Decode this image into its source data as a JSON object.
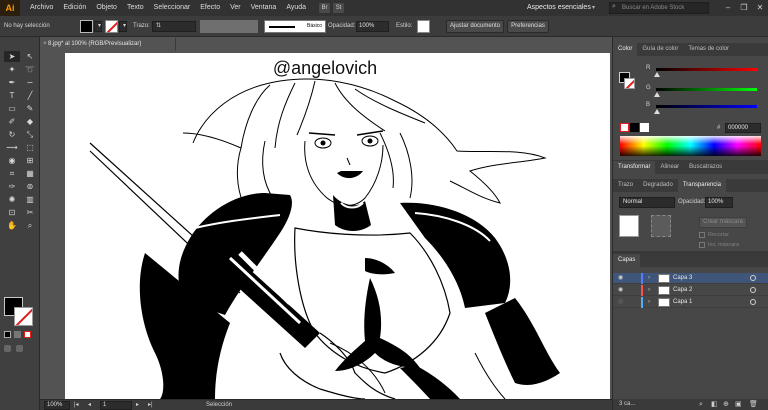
{
  "app": {
    "logo": "Ai"
  },
  "menu": [
    "Archivo",
    "Edición",
    "Objeto",
    "Texto",
    "Seleccionar",
    "Efecto",
    "Ver",
    "Ventana",
    "Ayuda"
  ],
  "bridge_icons": [
    "Br",
    "St"
  ],
  "workspace": {
    "label": "Aspectos esenciales",
    "arrow": "▾"
  },
  "search": {
    "placeholder": "Buscar en Adobe Stock",
    "icon": "search-icon"
  },
  "window_buttons": [
    "–",
    "❐",
    "✕"
  ],
  "control_bar": {
    "selection": "No hay selección",
    "stroke_label": "Trazo:",
    "stroke_profile": "Básico",
    "opacity_label": "Opacidad:",
    "opacity_value": "100%",
    "style_label": "Estilo:",
    "doc_setup_button": "Ajustar documento",
    "preferences_button": "Preferencias"
  },
  "document": {
    "tab_title": "8.jpg* al 100% (RGB/Previsualizar)",
    "close": "×",
    "watermark": "@angelovich"
  },
  "status_bar": {
    "zoom": "100%",
    "artboard": "1",
    "nav_first": "|◂",
    "nav_prev": "◂",
    "nav_next": "▸",
    "nav_last": "▸|",
    "tool": "Selección"
  },
  "color_panel": {
    "tabs": [
      "Color",
      "Guía de color",
      "Temas de color"
    ],
    "channels": [
      "R",
      "G",
      "B"
    ],
    "hex_label": "#",
    "hex_value": "000000"
  },
  "transform_panel": {
    "tabs": [
      "Transformar",
      "Alinear",
      "Buscatrazos"
    ]
  },
  "transparency_panel": {
    "tabs": [
      "Trazo",
      "Degradado",
      "Transparencia"
    ],
    "blend_mode": "Normal",
    "opacity_label": "Opacidad:",
    "opacity_value": "100%",
    "mask_button": "Crear máscara",
    "clip_label": "Recortar",
    "invert_label": "Inv. máscara"
  },
  "layers_panel": {
    "tab": "Capas",
    "layers": [
      {
        "name": "Capa 3",
        "color": "#4f7fff",
        "selected": true
      },
      {
        "name": "Capa 2",
        "color": "#ff4f4f",
        "selected": false
      },
      {
        "name": "Capa 1",
        "color": "#4fb0ff",
        "selected": false
      }
    ],
    "count": "3 ca..."
  },
  "colors": {
    "accent": "#ff9a00",
    "selection_row": "#3f5579",
    "stroke_none_red": "#e21b1b"
  }
}
